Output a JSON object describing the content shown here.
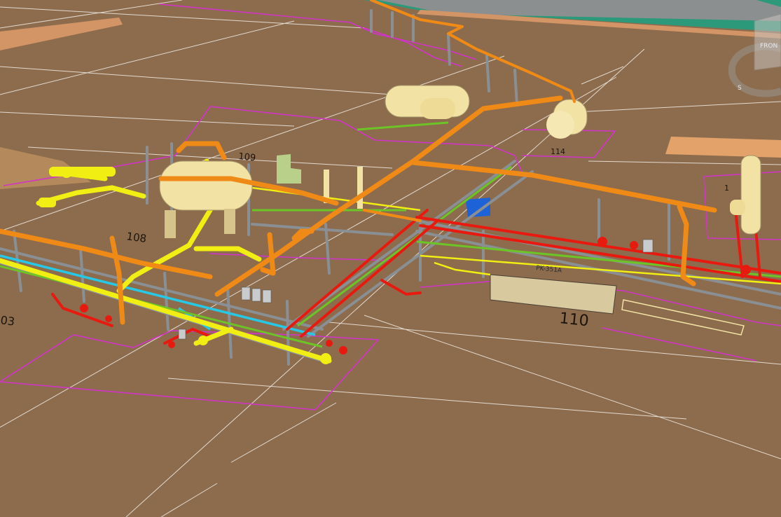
{
  "view": {
    "area_labels": {
      "a108": "108",
      "a109": "109",
      "a110": "110",
      "a114": "114",
      "a103": "03",
      "a1": "1"
    },
    "equipment_tag": "PK-351A",
    "cube": {
      "face_label": "FRON",
      "compass_south": "S",
      "compass_icon": "compass-ring-icon"
    },
    "colors": {
      "ground": "#8c6c4d",
      "area_boundary": "#d234c8",
      "grid": "#f2ede6",
      "pipe_orange": "#f08a16",
      "pipe_yellow": "#f0ee12",
      "pipe_red": "#e81a10",
      "pipe_cyan": "#27c8e6",
      "pipe_green": "#6cc426",
      "vessel": "#f2e2a4",
      "steel": "#8a8f93",
      "pad": "#e3a26a",
      "lawn": "#2c9a7a"
    }
  }
}
